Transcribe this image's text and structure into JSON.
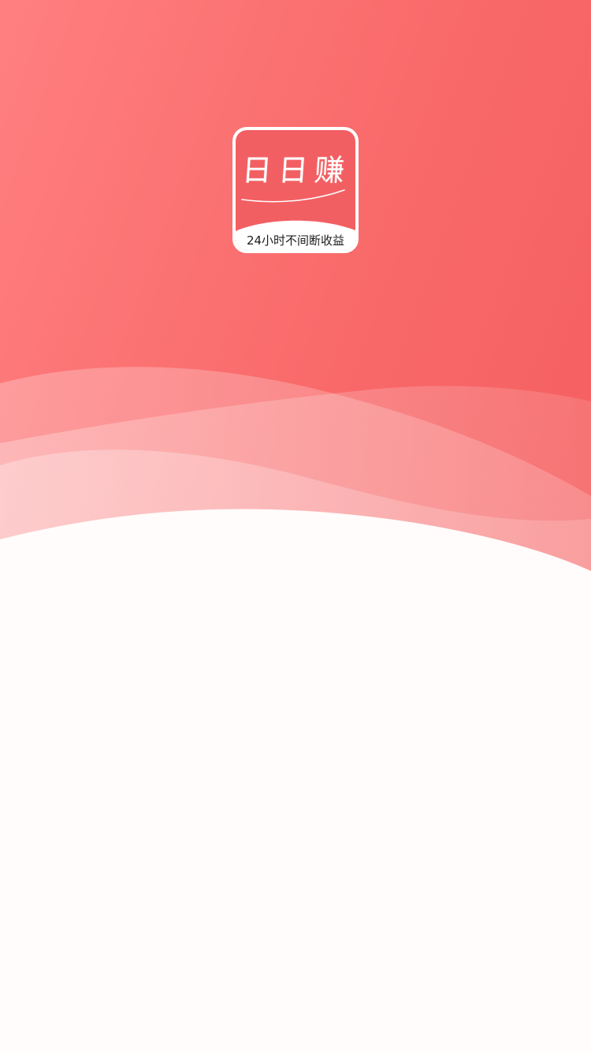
{
  "splash": {
    "app_name": "日日赚",
    "slogan": "24小时不间断收益"
  },
  "colors": {
    "background_top": "#ff7f80",
    "background_bottom": "#f55f60",
    "logo_red": "#f25f62",
    "wave_light": "#fde2e2",
    "page_white": "#fffcfb"
  },
  "icons": {
    "app_logo": "ri-ri-zhuan-logo"
  }
}
